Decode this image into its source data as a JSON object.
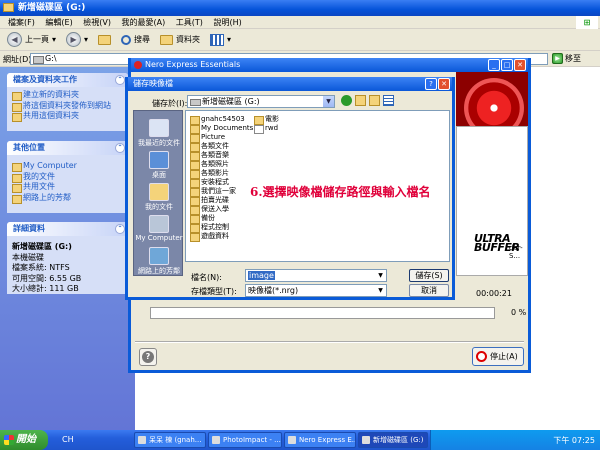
{
  "explorer": {
    "title": "新增磁碟區 (G:)",
    "menu": [
      "檔案(F)",
      "編輯(E)",
      "檢視(V)",
      "我的最愛(A)",
      "工具(T)",
      "說明(H)"
    ],
    "toolbar": {
      "back": "上一頁",
      "search": "搜尋",
      "folders": "資料夾"
    },
    "address_label": "網址(D)",
    "address_value": "G:\\",
    "go_label": "移至"
  },
  "leftpane": {
    "tasks_header": "檔案及資料夾工作",
    "tasks": [
      "建立新的資料夾",
      "將這個資料夾發佈到網站",
      "共用這個資料夾"
    ],
    "places_header": "其他位置",
    "places": [
      "My Computer",
      "我的文件",
      "共用文件",
      "網路上的芳鄰"
    ],
    "details_header": "詳細資料",
    "details": [
      "新增磁碟區 (G:)",
      "本機磁碟",
      "檔案系統: NTFS",
      "可用空間: 6.55 GB",
      "大小總計: 111 GB"
    ]
  },
  "nero": {
    "title": "Nero Express Essentials",
    "ultra": "ULTRA",
    "buffer": "BUFFER",
    "der_suffix": "der-S...",
    "elapsed": "00:00:21",
    "percent": "0 %",
    "progress_fraction": 0,
    "stop_label": "停止(A)"
  },
  "save_dialog": {
    "title": "儲存映像檔",
    "save_in_label": "儲存於(I):",
    "save_in_value": "新增磁碟區 (G:)",
    "places": [
      "我最近的文件",
      "桌面",
      "我的文件",
      "My Computer",
      "網路上的芳鄰"
    ],
    "files_col1": [
      "gnahc54503",
      "My Documents",
      "Picture",
      "各類文件",
      "各類音樂",
      "各類照片",
      "各類影片",
      "安裝程式",
      "我們這一家",
      "拍賣光碟",
      "保送入學",
      "備份",
      "程式控制",
      "遊戲資料"
    ],
    "files_col2": [
      "電影",
      "rwd"
    ],
    "filename_label": "檔名(N):",
    "filename_value": "image",
    "filetype_label": "存檔類型(T):",
    "filetype_value": "映像檔(*.nrg)",
    "save_button": "儲存(S)",
    "cancel_button": "取消"
  },
  "annotation": "6.選擇映像檔儲存路徑與輸入檔名",
  "taskbar": {
    "start": "開始",
    "lang": "CH",
    "tasks": [
      "呆呆 棟 (gnah...",
      "PhotoImpact - ...",
      "Nero Express E...",
      "新增磁碟區 (G:)"
    ],
    "clock": "下午 07:25"
  },
  "colors": {
    "xp_blue": "#0a5bd8",
    "annotation_red": "#e0003a",
    "left_pane": "#7ba2e7"
  }
}
